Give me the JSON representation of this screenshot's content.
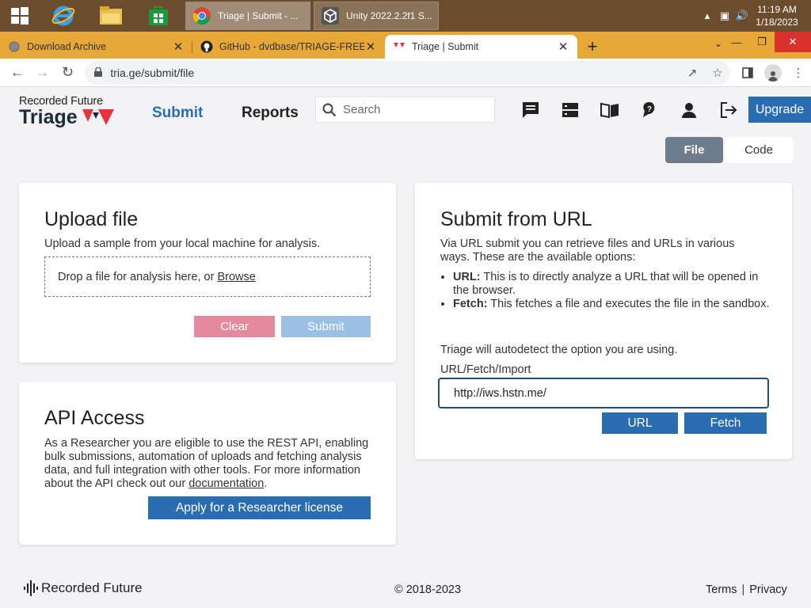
{
  "taskbar": {
    "tasks": [
      {
        "label": "Triage | Submit - ...",
        "icon": "chrome-icon"
      },
      {
        "label": "Unity 2022.2.2f1 S...",
        "icon": "unity-icon"
      }
    ],
    "clock": {
      "time": "11:19 AM",
      "date": "1/18/2023"
    }
  },
  "browser": {
    "tabs": [
      {
        "title": "Download Archive",
        "active": false
      },
      {
        "title": "GitHub - dvdbase/TRIAGE-FREE-",
        "active": false
      },
      {
        "title": "Triage | Submit",
        "active": true
      }
    ],
    "url": "tria.ge/submit/file"
  },
  "header": {
    "brand_top": "Recorded Future",
    "brand_name": "Triage",
    "nav": {
      "submit": "Submit",
      "reports": "Reports"
    },
    "search_placeholder": "Search",
    "upgrade_label": "Upgrade"
  },
  "toggle": {
    "file": "File",
    "code": "Code"
  },
  "upload": {
    "title": "Upload file",
    "description": "Upload a sample from your local machine for analysis.",
    "drop_text": "Drop a file for analysis here, or",
    "browse": "Browse",
    "clear": "Clear",
    "submit": "Submit"
  },
  "api": {
    "title": "API Access",
    "description": "As a Researcher you are eligible to use the REST API, enabling bulk submissions, automation of uploads and fetching analysis data, and full integration with other tools. For more information about the API check out our",
    "doc_link": "documentation",
    "period": ".",
    "apply": "Apply for a Researcher license"
  },
  "url_submit": {
    "title": "Submit from URL",
    "description": "Via URL submit you can retrieve files and URLs in various ways. These are the available options:",
    "options": [
      {
        "name": "URL:",
        "text": "This is to directly analyze a URL that will be opened in the browser."
      },
      {
        "name": "Fetch:",
        "text": "This fetches a file and executes the file in the sandbox."
      }
    ],
    "autodetect": "Triage will autodetect the option you are using.",
    "field_label": "URL/Fetch/Import",
    "field_value": "http://iws.hstn.me/",
    "url_button": "URL",
    "fetch_button": "Fetch"
  },
  "footer": {
    "brand": "Recorded Future",
    "copyright": "© 2018-2023",
    "terms": "Terms",
    "separator": "|",
    "privacy": "Privacy"
  },
  "colors": {
    "primary": "#2a6cb0",
    "clear": "#e48a9c",
    "submit_disabled": "#9cc0e4",
    "toggle_active": "#6e7b8b",
    "brand_red": "#e8333b"
  }
}
